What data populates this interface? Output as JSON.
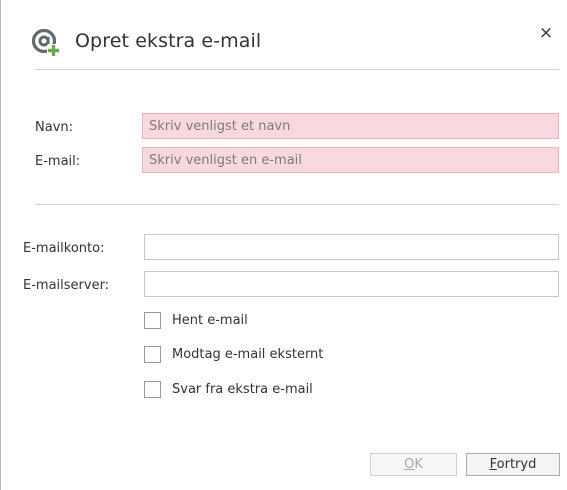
{
  "dialog": {
    "title": "Opret ekstra e-mail",
    "icon": "at-plus-icon",
    "close_label": "×"
  },
  "identity": {
    "name_label": "Navn:",
    "name_value": "",
    "name_placeholder": "Skriv venligst et navn",
    "email_label": "E-mail:",
    "email_value": "",
    "email_placeholder": "Skriv venligst en e-mail"
  },
  "account": {
    "account_label": "E-mailkonto:",
    "account_value": "",
    "server_label": "E-mailserver:",
    "server_value": ""
  },
  "options": [
    {
      "label": "Hent e-mail",
      "checked": false
    },
    {
      "label": "Modtag e-mail eksternt",
      "checked": false
    },
    {
      "label": "Svar fra ekstra e-mail",
      "checked": false
    }
  ],
  "buttons": {
    "ok_key": "O",
    "ok_rest": "K",
    "ok_enabled": false,
    "cancel_key": "F",
    "cancel_rest": "ortryd"
  },
  "colors": {
    "invalid_field_bg": "#f9d9df",
    "icon_at": "#5f6b6b",
    "icon_plus": "#6aa84f"
  }
}
